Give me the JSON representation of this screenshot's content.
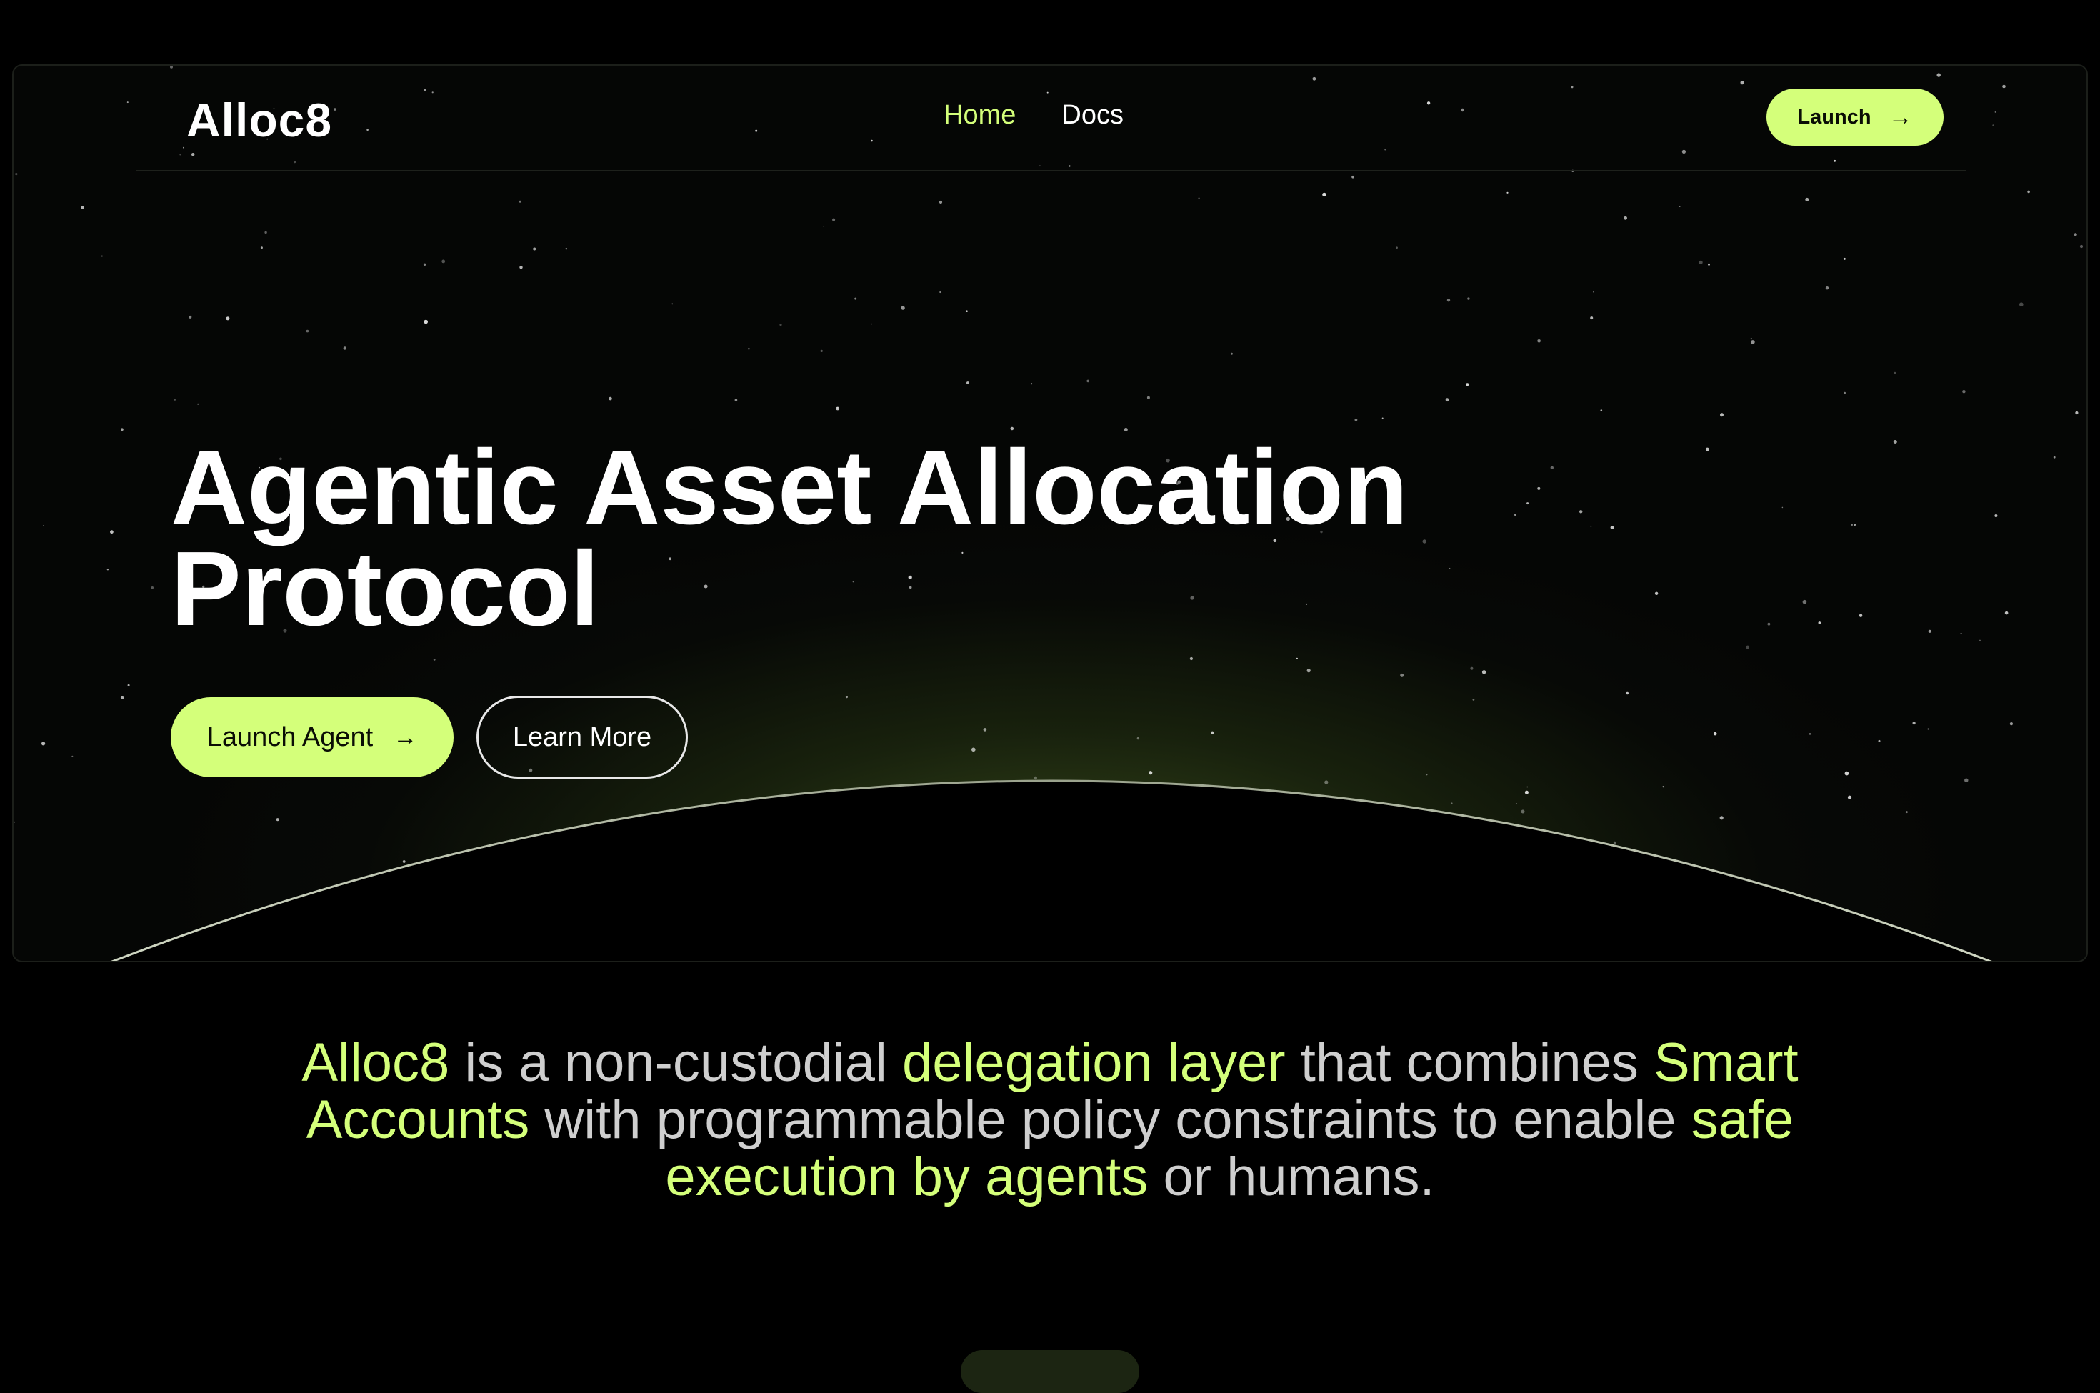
{
  "nav": {
    "logo": "Alloc8",
    "links": [
      {
        "label": "Home",
        "active": true
      },
      {
        "label": "Docs",
        "active": false
      }
    ],
    "launch_label": "Launch",
    "launch_icon": "arrow-right-icon"
  },
  "hero": {
    "headline_line1": "Agentic Asset Allocation",
    "headline_line2": "Protocol",
    "primary_cta": "Launch Agent",
    "primary_cta_icon": "arrow-right-icon",
    "secondary_cta": "Learn More"
  },
  "tagline": {
    "parts": [
      {
        "text": "Alloc8",
        "highlight": true
      },
      {
        "text": " is a non-custodial ",
        "highlight": false
      },
      {
        "text": "delegation layer",
        "highlight": true
      },
      {
        "text": " that combines ",
        "highlight": false
      },
      {
        "text": "Smart Accounts",
        "highlight": true
      },
      {
        "text": " with programmable policy constraints to enable ",
        "highlight": false
      },
      {
        "text": "safe execution by agents",
        "highlight": true
      },
      {
        "text": " or humans.",
        "highlight": false
      }
    ]
  },
  "colors": {
    "accent": "#d4ff7a",
    "background": "#000000",
    "body_text": "#cfcfcf"
  }
}
